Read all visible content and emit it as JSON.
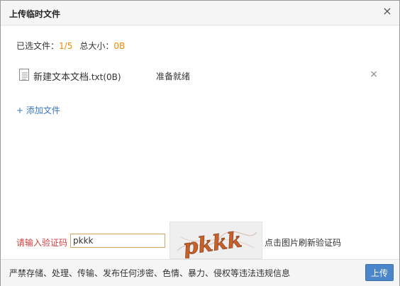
{
  "dialog": {
    "title": "上传临时文件",
    "close_icon": "close-icon"
  },
  "summary": {
    "selected_label": "已选文件：",
    "selected_value": "1/5",
    "size_label": "总大小：",
    "size_value": "0B"
  },
  "files": [
    {
      "icon": "text-file-icon",
      "name": "新建文本文档",
      "ext_size": ".txt(0B)",
      "status": "准备就绪",
      "remove_icon": "remove-icon"
    }
  ],
  "add_file": {
    "label": "+ 添加文件"
  },
  "captcha": {
    "label": "请输入验证码",
    "input_value": "pkkk",
    "hint": "点击图片刷新验证码",
    "image_text": "pkkk"
  },
  "footer": {
    "note": "严禁存储、处理、传输、发布任何涉密、色情、暴力、侵权等违法违规信息",
    "upload_label": "上传"
  },
  "colors": {
    "accent": "#4a86c9",
    "link": "#3a77c4",
    "highlight": "#f08a00",
    "warning_label": "#d04040",
    "captcha_text": "#c8602a"
  }
}
